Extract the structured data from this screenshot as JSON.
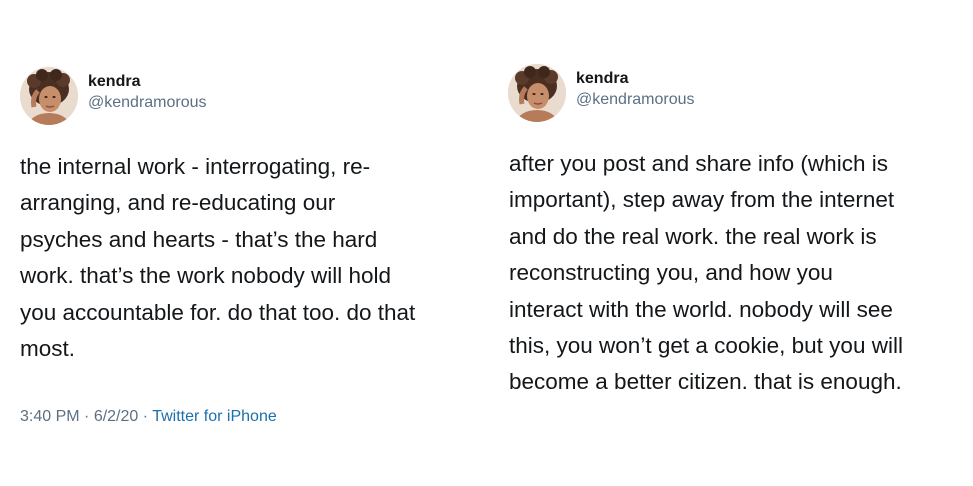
{
  "tweets": [
    {
      "author": {
        "name": "kendra",
        "handle": "@kendramorous",
        "avatar_icon": "avatar-photo"
      },
      "text": "the internal work - interrogating, re-\narranging, and re-educating our\npsyches and hearts - that’s the hard\nwork. that’s the work nobody will hold\nyou accountable for. do that too. do that\nmost.",
      "meta": {
        "time": "3:40 PM",
        "date": "6/2/20",
        "separator": " · ",
        "source": "Twitter for iPhone"
      }
    },
    {
      "author": {
        "name": "kendra",
        "handle": "@kendramorous",
        "avatar_icon": "avatar-photo"
      },
      "text": "after you post and share info (which is\nimportant), step away from the internet\nand do the real work. the real work is\nreconstructing you, and how you\ninteract with the world. nobody will see\nthis, you won’t get a cookie, but you will\nbecome a better citizen. that is enough."
    }
  ],
  "colors": {
    "text": "#14171a",
    "secondary": "#5b7083",
    "link": "#1b6fab",
    "background": "#ffffff"
  }
}
